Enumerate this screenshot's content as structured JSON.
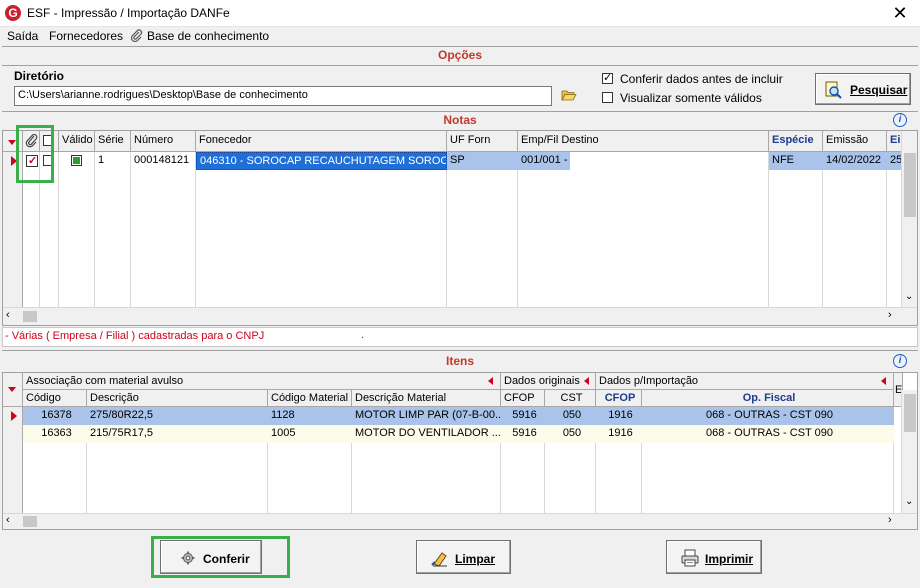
{
  "window": {
    "title": "ESF - Impressão / Importação DANFe",
    "icon_letter": "G",
    "close_glyph": "✕"
  },
  "menu": {
    "items": [
      "Saída",
      "Fornecedores",
      "Base de conhecimento"
    ]
  },
  "opcoes": {
    "section_title": "Opções",
    "directory_label": "Diretório",
    "directory_value": "C:\\Users\\arianne.rodrigues\\Desktop\\Base de conhecimento",
    "chk_conferir_label": "Conferir dados antes de incluir",
    "chk_conferir_checked": true,
    "chk_validos_label": "Visualizar somente válidos",
    "chk_validos_checked": false,
    "pesquisar_label": "Pesquisar"
  },
  "notas": {
    "section_title": "Notas",
    "columns": [
      "Válido",
      "Série",
      "Número",
      "Fonecedor",
      "UF Forn",
      "Emp/Fil Destino",
      "Espécie",
      "Emissão",
      "Ei"
    ],
    "rows": [
      {
        "valido": true,
        "serie": "1",
        "numero": "000148121",
        "fornecedor": "046310 - SOROCAP RECAUCHUTAGEM SOROC...",
        "uf": "SP",
        "destino": "001/001 -",
        "especie": "NFE",
        "emissao": "14/02/2022",
        "extra": "25"
      }
    ]
  },
  "status_message": "- Várias ( Empresa / Filial ) cadastradas para o CNPJ",
  "status_dot": ".",
  "itens": {
    "section_title": "Itens",
    "groups": [
      "Associação com material avulso",
      "Dados originais",
      "Dados p/Importação",
      "E"
    ],
    "columns": [
      "Código",
      "Descrição",
      "Código Material",
      "Descrição Material",
      "CFOP",
      "CST",
      "CFOP",
      "Op. Fiscal"
    ],
    "rows": [
      {
        "codigo": "16378",
        "descricao": "275/80R22,5",
        "cod_material": "1128",
        "desc_material": "MOTOR LIMP PAR (07-B-00...",
        "cfop": "5916",
        "cst": "050",
        "cfop2": "1916",
        "op_fiscal": "068 - OUTRAS - CST 090"
      },
      {
        "codigo": "16363",
        "descricao": "215/75R17,5",
        "cod_material": "1005",
        "desc_material": "MOTOR DO VENTILADOR ...",
        "cfop": "5916",
        "cst": "050",
        "cfop2": "1916",
        "op_fiscal": "068 - OUTRAS - CST 090"
      }
    ]
  },
  "buttons": {
    "conferir": "Conferir",
    "limpar": "Limpar",
    "imprimir": "Imprimir"
  },
  "colors": {
    "accent_red": "#c0392b",
    "selection": "#a9c3ea",
    "highlight_green": "#3aae48",
    "header_blue": "#1d3b8f"
  }
}
